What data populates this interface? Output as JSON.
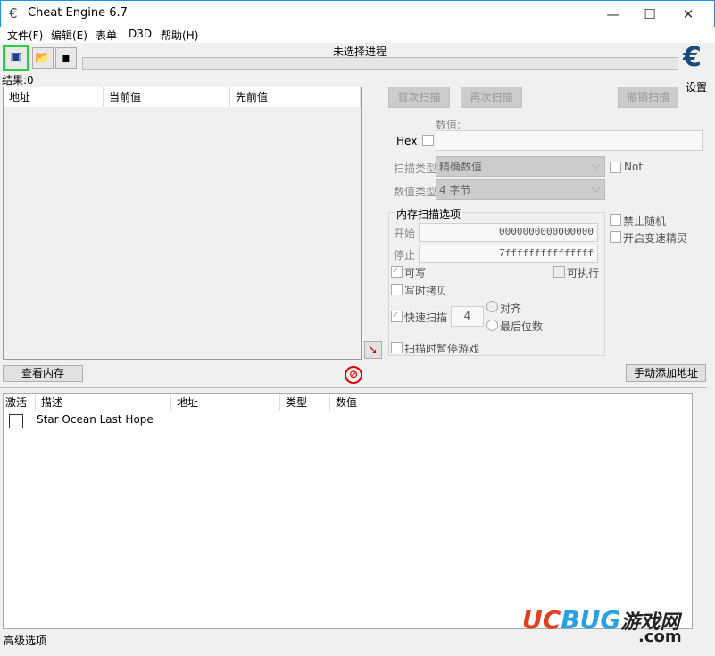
{
  "window": {
    "title": "Cheat Engine 6.7",
    "minimize": "—",
    "maximize": "☐",
    "close": "✕"
  },
  "menu": [
    "文件(F)",
    "编辑(E)",
    "表单",
    "D3D",
    "帮助(H)"
  ],
  "process": {
    "label": "未选择进程",
    "progress": 0
  },
  "settings_label": "设置",
  "results": "结果:0",
  "results_columns": [
    "地址",
    "当前值",
    "先前值"
  ],
  "scan": {
    "first": "首次扫描",
    "next": "再次扫描",
    "undo": "撤销扫描",
    "value_label": "数值:",
    "hex": "Hex",
    "scan_type_label": "扫描类型",
    "scan_type": "精确数值",
    "value_type_label": "数值类型",
    "value_type": "4 字节",
    "not": "Not"
  },
  "memory": {
    "title": "内存扫描选项",
    "start_label": "开始",
    "start": "0000000000000000",
    "stop_label": "停止",
    "stop": "7fffffffffffffff",
    "writable": "可写",
    "executable": "可执行",
    "copy_on_write": "写时拷贝",
    "fast_scan": "快速扫描",
    "fast_scan_value": "4",
    "align": "对齐",
    "last_digits": "最后位数",
    "pause": "扫描时暂停游戏"
  },
  "side": {
    "no_random": "禁止随机",
    "speedhack": "开启变速精灵"
  },
  "view_memory": "查看内存",
  "add_address": "手动添加地址",
  "table_columns": [
    "激活",
    "描述",
    "地址",
    "类型",
    "数值"
  ],
  "table_rows": [
    {
      "active": false,
      "description": "Star Ocean Last Hope"
    }
  ],
  "advanced": "高级选项",
  "watermark": "UCBUG游戏网 .com",
  "colors": {
    "accent": "#1e90e6",
    "highlight": "#2ecc40"
  }
}
